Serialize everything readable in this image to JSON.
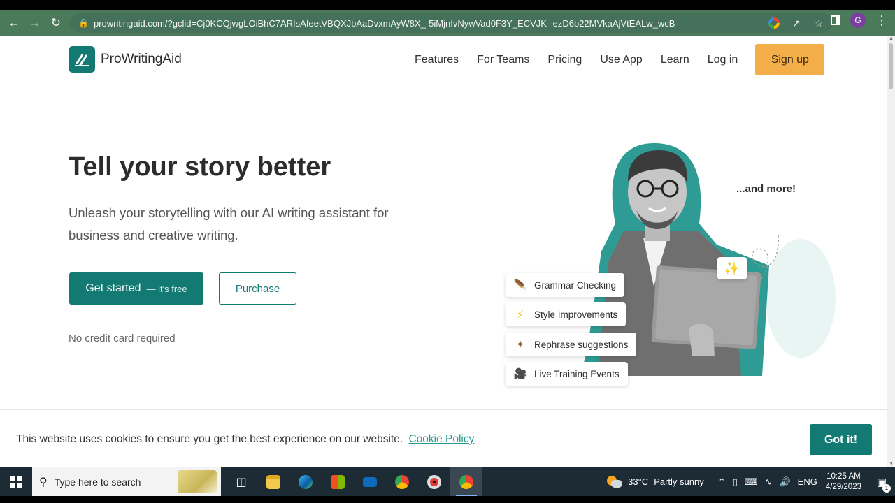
{
  "browser": {
    "url": "prowritingaid.com/?gclid=Cj0KCQjwgLOiBhC7ARIsAIeetVBQXJbAaDvxmAyW8X_-5iMjnIvNywVad0F3Y_ECVJK--ezD6b22MVkaAjVtEALw_wcB",
    "profile_initial": "G"
  },
  "site": {
    "logo_text": "ProWritingAid",
    "nav": [
      "Features",
      "For Teams",
      "Pricing",
      "Use App",
      "Learn",
      "Log in"
    ],
    "signup_label": "Sign up"
  },
  "hero": {
    "title": "Tell your story better",
    "subtitle": "Unleash your storytelling with our AI writing assistant for business and creative writing.",
    "cta_primary": "Get started",
    "cta_primary_note": "— it's free",
    "cta_secondary": "Purchase",
    "note": "No credit card required"
  },
  "illustration": {
    "more_label": "...and more!",
    "features": [
      {
        "label": "Grammar Checking",
        "icon": "feather-icon"
      },
      {
        "label": "Style Improvements",
        "icon": "lightning-icon"
      },
      {
        "label": "Rephrase suggestions",
        "icon": "magic-wand-icon"
      },
      {
        "label": "Live Training Events",
        "icon": "video-camera-icon"
      }
    ]
  },
  "cookie": {
    "text": "This website uses cookies to ensure you get the best experience on our website.",
    "link": "Cookie Policy",
    "button": "Got it!"
  },
  "taskbar": {
    "search_placeholder": "Type here to search",
    "weather_temp": "33°C",
    "weather_desc": "Partly sunny",
    "lang": "ENG",
    "time": "10:25 AM",
    "date": "4/29/2023",
    "notification_count": "1"
  },
  "colors": {
    "brand_teal": "#137a73",
    "signup_orange": "#f3ae4a",
    "browser_frame": "#4a7a5a"
  }
}
